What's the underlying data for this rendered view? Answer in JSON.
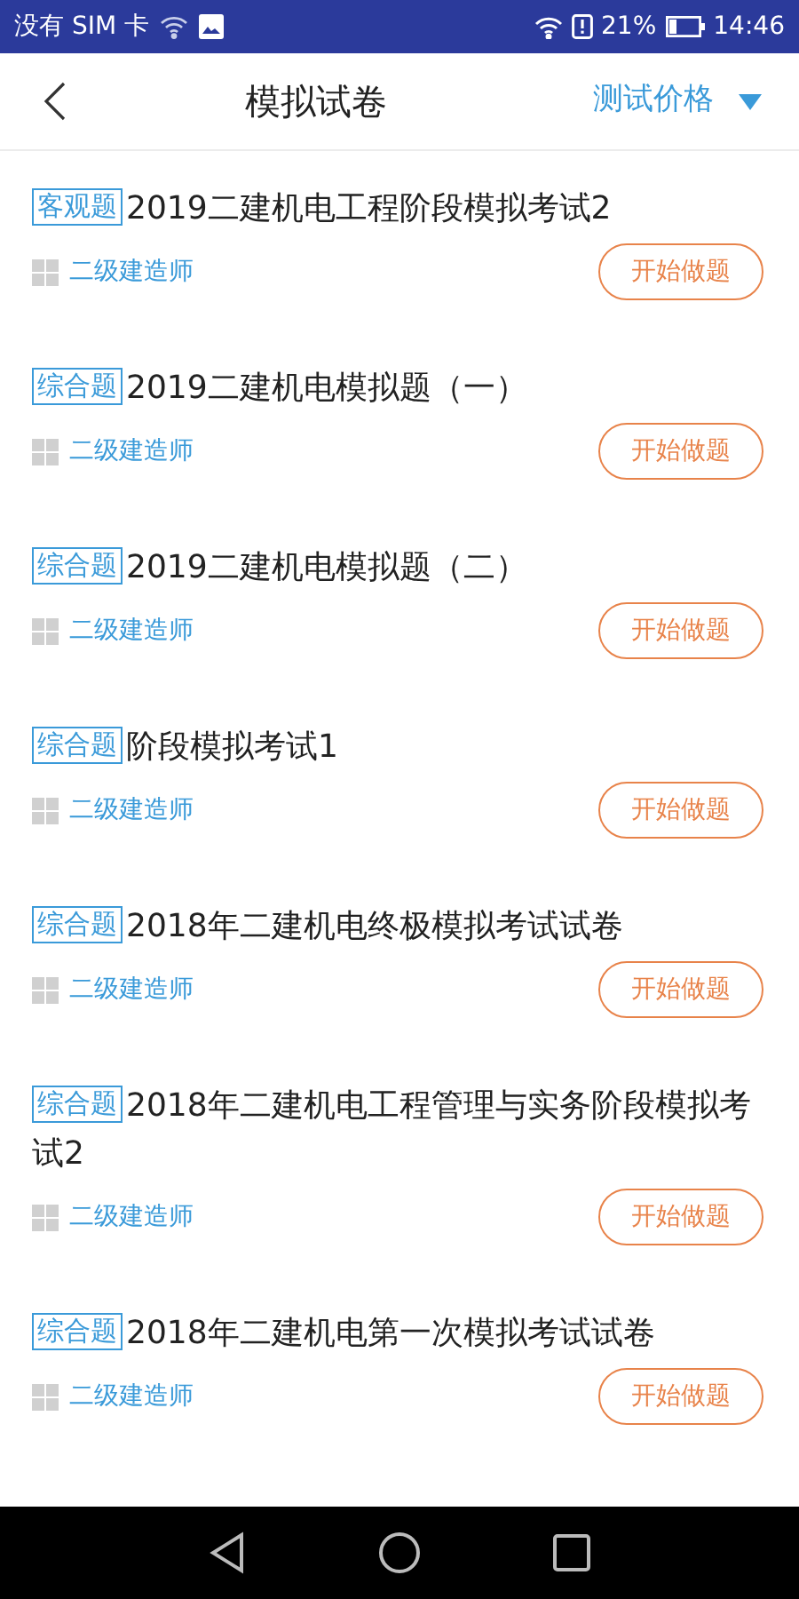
{
  "status_bar": {
    "carrier": "没有 SIM 卡",
    "battery": "21%",
    "time": "14:46"
  },
  "header": {
    "title": "模拟试卷",
    "filter": "测试价格"
  },
  "papers": [
    {
      "tag": "客观题",
      "title": "2019二建机电工程阶段模拟考试2",
      "category": "二级建造师",
      "action": "开始做题"
    },
    {
      "tag": "综合题",
      "title": "2019二建机电模拟题（一）",
      "category": "二级建造师",
      "action": "开始做题"
    },
    {
      "tag": "综合题",
      "title": "2019二建机电模拟题（二）",
      "category": "二级建造师",
      "action": "开始做题"
    },
    {
      "tag": "综合题",
      "title": "阶段模拟考试1",
      "category": "二级建造师",
      "action": "开始做题"
    },
    {
      "tag": "综合题",
      "title": "2018年二建机电终极模拟考试试卷",
      "category": "二级建造师",
      "action": "开始做题"
    },
    {
      "tag": "综合题",
      "title": "2018年二建机电工程管理与实务阶段模拟考试2",
      "category": "二级建造师",
      "action": "开始做题"
    },
    {
      "tag": "综合题",
      "title": "2018年二建机电第一次模拟考试试卷",
      "category": "二级建造师",
      "action": "开始做题"
    }
  ]
}
